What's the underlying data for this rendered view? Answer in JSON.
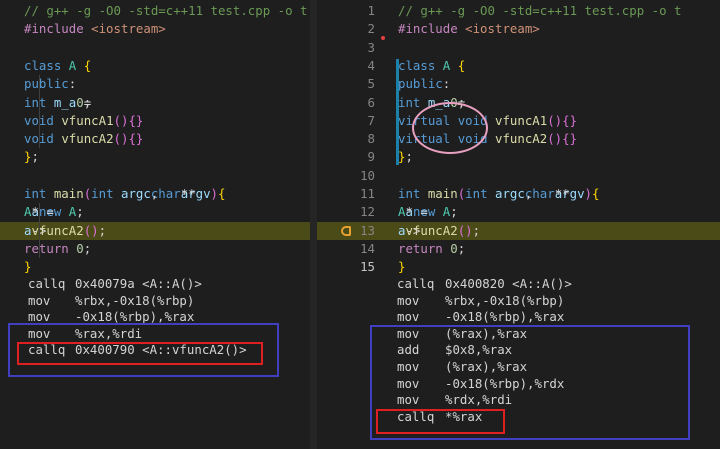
{
  "left": {
    "code": [
      {
        "parts": [
          [
            "cmt",
            "// g++ -g -O0 -std=c++11 test.cpp -o t"
          ]
        ]
      },
      {
        "parts": [
          [
            "pp",
            "#include "
          ],
          [
            "st",
            "<iostream>"
          ]
        ]
      },
      {
        "parts": []
      },
      {
        "parts": [
          [
            "kw",
            "class "
          ],
          [
            "ty",
            "A "
          ],
          [
            "br",
            "{"
          ]
        ]
      },
      {
        "parts": [
          [
            "txt",
            "  "
          ],
          [
            "kw",
            "public"
          ],
          [
            "txt",
            ":"
          ]
        ]
      },
      {
        "parts": [
          [
            "txt",
            "   "
          ],
          [
            "kw",
            "int "
          ],
          [
            "va",
            "m_a"
          ],
          [
            "txt",
            " = "
          ],
          [
            "nu",
            "0"
          ],
          [
            "txt",
            ";"
          ]
        ]
      },
      {
        "parts": [
          [
            "txt",
            "   "
          ],
          [
            "kw",
            "void "
          ],
          [
            "fn",
            "vfuncA1"
          ],
          [
            "br2",
            "()"
          ],
          [
            "txt",
            " "
          ],
          [
            "br2",
            "{}"
          ]
        ]
      },
      {
        "parts": [
          [
            "txt",
            "   "
          ],
          [
            "kw",
            "void "
          ],
          [
            "fn",
            "vfuncA2"
          ],
          [
            "br2",
            "()"
          ],
          [
            "txt",
            " "
          ],
          [
            "br2",
            "{}"
          ]
        ]
      },
      {
        "parts": [
          [
            "br",
            "}"
          ],
          [
            "txt",
            ";"
          ]
        ]
      },
      {
        "parts": []
      },
      {
        "parts": [
          [
            "kw",
            "int "
          ],
          [
            "fn",
            "main"
          ],
          [
            "br2",
            "("
          ],
          [
            "kw",
            "int "
          ],
          [
            "va",
            "argc"
          ],
          [
            "txt",
            ", "
          ],
          [
            "kw",
            "char"
          ],
          [
            "txt",
            "** "
          ],
          [
            "va",
            "argv"
          ],
          [
            "br2",
            ")"
          ],
          [
            "txt",
            " "
          ],
          [
            "br",
            "{"
          ]
        ]
      },
      {
        "parts": [
          [
            "txt",
            "   "
          ],
          [
            "ty",
            "A"
          ],
          [
            "txt",
            "* "
          ],
          [
            "va",
            "a"
          ],
          [
            "txt",
            " = "
          ],
          [
            "kw",
            "new "
          ],
          [
            "ty",
            "A"
          ],
          [
            "txt",
            ";"
          ]
        ]
      },
      {
        "parts": [
          [
            "txt",
            "   "
          ],
          [
            "va",
            "a"
          ],
          [
            "txt",
            "->"
          ],
          [
            "fn",
            "vfuncA2"
          ],
          [
            "br2",
            "()"
          ],
          [
            "txt",
            ";"
          ]
        ],
        "highlight": true
      },
      {
        "parts": [
          [
            "txt",
            "   "
          ],
          [
            "pp",
            "return "
          ],
          [
            "nu",
            "0"
          ],
          [
            "txt",
            ";"
          ]
        ]
      },
      {
        "parts": [
          [
            "br",
            "}"
          ]
        ]
      }
    ],
    "asm": [
      {
        "op": "callq",
        "arg": "0x40079a <A::A()>"
      },
      {
        "op": "mov",
        "arg": "%rbx,-0x18(%rbp)"
      },
      {
        "op": "mov",
        "arg": "-0x18(%rbp),%rax"
      },
      {
        "op": "mov",
        "arg": "%rax,%rdi"
      },
      {
        "op": "callq",
        "arg": "0x400790 <A::vfuncA2()>"
      }
    ]
  },
  "right": {
    "line_numbers": [
      "1",
      "2",
      "3",
      "4",
      "5",
      "6",
      "7",
      "8",
      "9",
      "10",
      "11",
      "12",
      "13",
      "14",
      "15"
    ],
    "active_line": "15",
    "code": [
      {
        "parts": [
          [
            "cmt",
            "// g++ -g -O0 -std=c++11 test.cpp -o t"
          ]
        ]
      },
      {
        "parts": [
          [
            "pp",
            "#include "
          ],
          [
            "st",
            "<iostream>"
          ]
        ]
      },
      {
        "parts": []
      },
      {
        "parts": [
          [
            "kw",
            "class "
          ],
          [
            "ty",
            "A "
          ],
          [
            "br",
            "{"
          ]
        ]
      },
      {
        "parts": [
          [
            "txt",
            "  "
          ],
          [
            "kw",
            "public"
          ],
          [
            "txt",
            ":"
          ]
        ]
      },
      {
        "parts": [
          [
            "txt",
            "   "
          ],
          [
            "kw",
            "int "
          ],
          [
            "va",
            "m_a"
          ],
          [
            "txt",
            " = "
          ],
          [
            "nu",
            "0"
          ],
          [
            "txt",
            ";"
          ]
        ]
      },
      {
        "parts": [
          [
            "txt",
            "  "
          ],
          [
            "kw",
            "virtual "
          ],
          [
            "kw",
            "void "
          ],
          [
            "fn",
            "vfuncA1"
          ],
          [
            "br2",
            "()"
          ],
          [
            "txt",
            " "
          ],
          [
            "br2",
            "{}"
          ]
        ]
      },
      {
        "parts": [
          [
            "txt",
            "  "
          ],
          [
            "kw",
            "virtual "
          ],
          [
            "kw",
            "void "
          ],
          [
            "fn",
            "vfuncA2"
          ],
          [
            "br2",
            "()"
          ],
          [
            "txt",
            " "
          ],
          [
            "br2",
            "{}"
          ]
        ]
      },
      {
        "parts": [
          [
            "br",
            "}"
          ],
          [
            "txt",
            ";"
          ]
        ]
      },
      {
        "parts": []
      },
      {
        "parts": [
          [
            "kw",
            "int "
          ],
          [
            "fn",
            "main"
          ],
          [
            "br2",
            "("
          ],
          [
            "kw",
            "int "
          ],
          [
            "va",
            "argc"
          ],
          [
            "txt",
            ", "
          ],
          [
            "kw",
            "char"
          ],
          [
            "txt",
            "** "
          ],
          [
            "va",
            "argv"
          ],
          [
            "br2",
            ")"
          ],
          [
            "txt",
            " "
          ],
          [
            "br",
            "{"
          ]
        ]
      },
      {
        "parts": [
          [
            "txt",
            "   "
          ],
          [
            "ty",
            "A"
          ],
          [
            "txt",
            "* "
          ],
          [
            "va",
            "a"
          ],
          [
            "txt",
            " = "
          ],
          [
            "kw",
            "new "
          ],
          [
            "ty",
            "A"
          ],
          [
            "txt",
            ";"
          ]
        ]
      },
      {
        "parts": [
          [
            "txt",
            "   "
          ],
          [
            "va",
            "a"
          ],
          [
            "txt",
            "->"
          ],
          [
            "fn",
            "vfuncA2"
          ],
          [
            "br2",
            "()"
          ],
          [
            "txt",
            ";"
          ]
        ],
        "highlight": true
      },
      {
        "parts": [
          [
            "txt",
            "   "
          ],
          [
            "pp",
            "return "
          ],
          [
            "nu",
            "0"
          ],
          [
            "txt",
            ";"
          ]
        ]
      },
      {
        "parts": [
          [
            "br",
            "}"
          ]
        ]
      }
    ],
    "asm": [
      {
        "op": "callq",
        "arg": "0x400820 <A::A()>"
      },
      {
        "op": "mov",
        "arg": "%rbx,-0x18(%rbp)"
      },
      {
        "op": "mov",
        "arg": "-0x18(%rbp),%rax"
      },
      {
        "op": "mov",
        "arg": "(%rax),%rax"
      },
      {
        "op": "add",
        "arg": "$0x8,%rax"
      },
      {
        "op": "mov",
        "arg": "(%rax),%rax"
      },
      {
        "op": "mov",
        "arg": "-0x18(%rbp),%rdx"
      },
      {
        "op": "mov",
        "arg": "%rdx,%rdi"
      },
      {
        "op": "callq",
        "arg": "*%rax"
      }
    ]
  },
  "colors": {
    "background": "#1e1e1e",
    "highlight_line": "#4b4b18",
    "annotation_blue": "#3f3fbf",
    "annotation_red": "#e02020",
    "annotation_pink": "#e8a0c0"
  }
}
